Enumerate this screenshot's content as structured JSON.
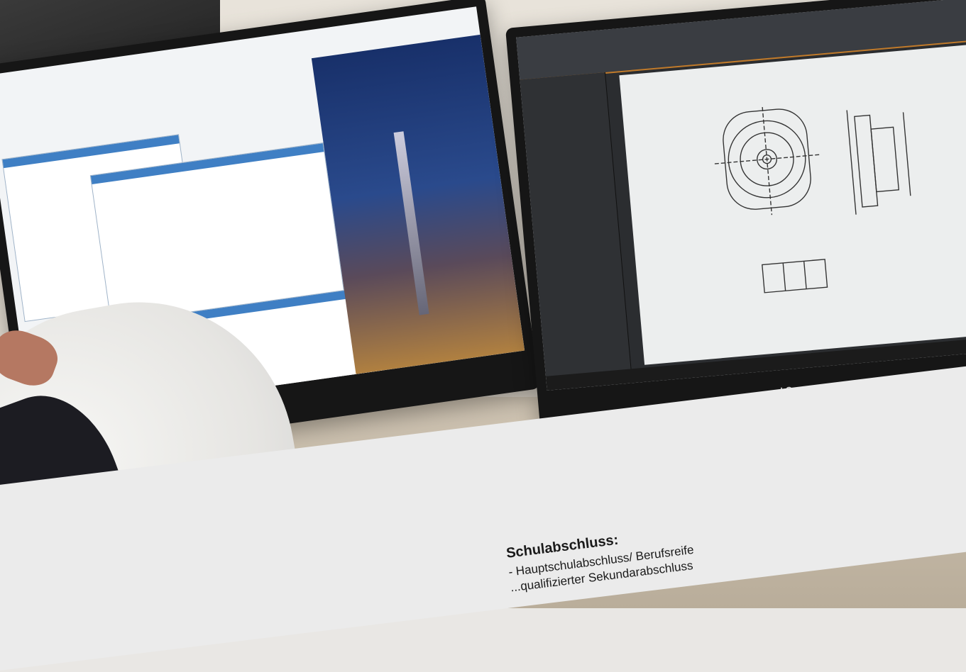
{
  "monitor": {
    "brand": "LG"
  },
  "info": {
    "heading": "Schulabschluss:",
    "line1": "- Hauptschulabschluss/ Berufsreife",
    "line2": "...qualifizierter Sekundarabschluss"
  }
}
